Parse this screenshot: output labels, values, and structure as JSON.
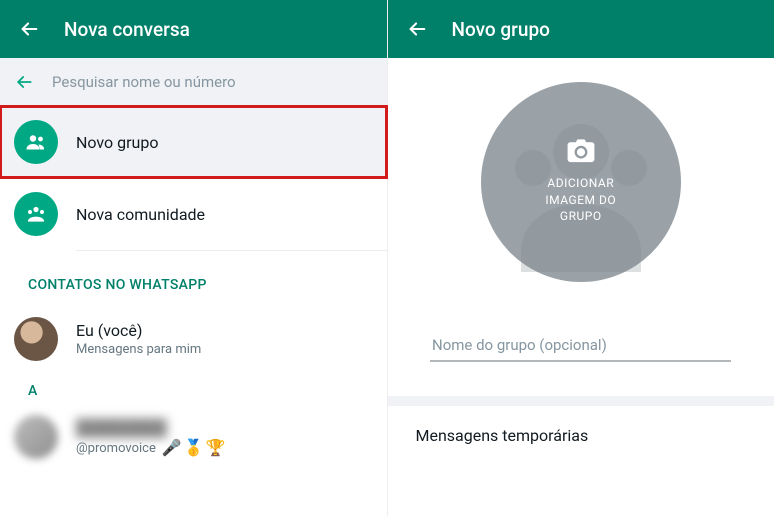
{
  "left": {
    "headerTitle": "Nova conversa",
    "searchPlaceholder": "Pesquisar nome ou número",
    "options": {
      "novoGrupo": "Novo grupo",
      "novaComunidade": "Nova comunidade"
    },
    "sectionHeader": "CONTATOS NO WHATSAPP",
    "contactSelf": {
      "name": "Eu (você)",
      "sub": "Mensagens para mim"
    },
    "letterHeader": "A",
    "blurredHandle": "@promovoice",
    "emojiLine": "🎤🥇🏆"
  },
  "right": {
    "headerTitle": "Novo grupo",
    "addPhotoLine1": "ADICIONAR",
    "addPhotoLine2": "IMAGEM DO",
    "addPhotoLine3": "GRUPO",
    "groupNamePlaceholder": "Nome do grupo (opcional)",
    "tempMessages": "Mensagens temporárias"
  }
}
